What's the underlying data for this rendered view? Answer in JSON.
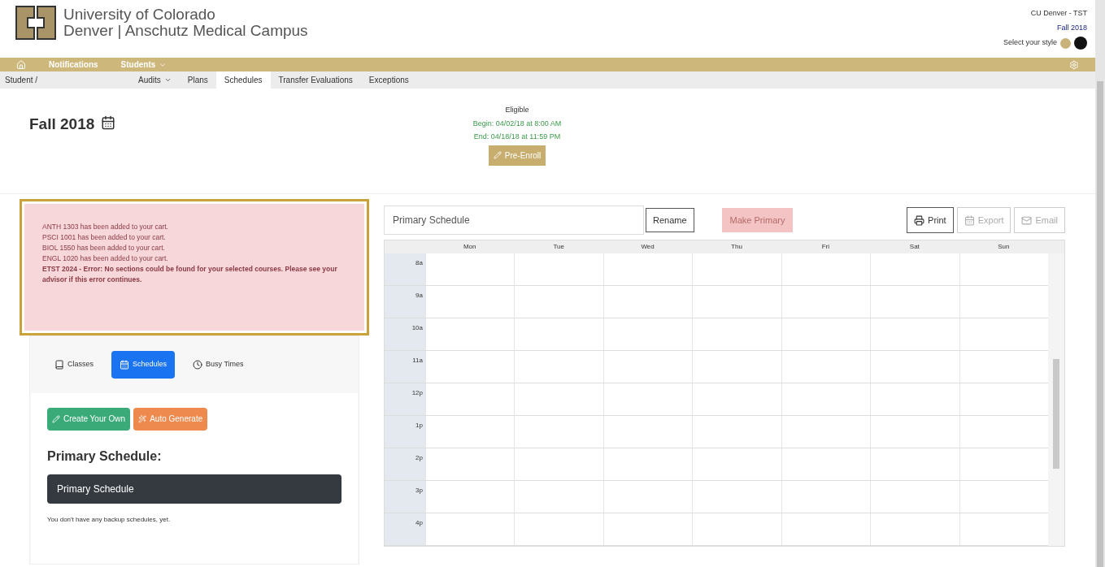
{
  "header": {
    "university": "University of Colorado",
    "campus": "Denver | Anschutz Medical Campus",
    "user": "CU Denver - TST",
    "term": "Fall 2018",
    "style_label": "Select your style",
    "styles": [
      {
        "color": "#c8b27a",
        "selected": false
      },
      {
        "color": "#111111",
        "selected": true
      }
    ]
  },
  "navbar": {
    "items": [
      {
        "label": "Notifications",
        "dropdown": false
      },
      {
        "label": "Students",
        "dropdown": true
      }
    ]
  },
  "subnav": {
    "breadcrumb": "Student /",
    "tabs": [
      {
        "label": "Audits",
        "dropdown": true,
        "selected": false
      },
      {
        "label": "Plans",
        "dropdown": false,
        "selected": false
      },
      {
        "label": "Schedules",
        "dropdown": false,
        "selected": true
      },
      {
        "label": "Transfer Evaluations",
        "dropdown": false,
        "selected": false
      },
      {
        "label": "Exceptions",
        "dropdown": false,
        "selected": false
      }
    ]
  },
  "term_title": "Fall 2018",
  "enrollment": {
    "status": "Eligible",
    "begin": "Begin: 04/02/18 at 8:00 AM",
    "end": "End: 04/18/18 at 11:59 PM",
    "button": "Pre-Enroll"
  },
  "alert": {
    "messages": [
      {
        "text": "ANTH 1303 has been added to your cart.",
        "kind": "info"
      },
      {
        "text": "PSCI 1001 has been added to your cart.",
        "kind": "info"
      },
      {
        "text": "BIOL 1550 has been added to your cart.",
        "kind": "info"
      },
      {
        "text": "ENGL 1020 has been added to your cart.",
        "kind": "info"
      },
      {
        "text": "ETST 2024 - Error: No sections could be found for your selected courses. Please see your advisor if this error continues.",
        "kind": "error"
      }
    ]
  },
  "left_panel": {
    "tabs": [
      {
        "label": "Classes",
        "selected": false
      },
      {
        "label": "Schedules",
        "selected": true
      },
      {
        "label": "Busy Times",
        "selected": false
      }
    ],
    "buttons": [
      {
        "label": "Create Your Own",
        "kind": "create"
      },
      {
        "label": "Auto Generate",
        "kind": "generate"
      }
    ],
    "heading": "Primary Schedule:",
    "primary": "Primary Schedule",
    "note": "You don't have any backup schedules, yet."
  },
  "calendar": {
    "name_value": "Primary Schedule",
    "rename": "Rename",
    "make_primary": {
      "label": "Make Primary",
      "disabled": true
    },
    "actions": [
      {
        "label": "Print",
        "disabled": false,
        "kind": "print"
      },
      {
        "label": "Export",
        "disabled": true,
        "kind": "export"
      },
      {
        "label": "Email",
        "disabled": true,
        "kind": "email"
      }
    ],
    "days": [
      "Mon",
      "Tue",
      "Wed",
      "Thu",
      "Fri",
      "Sat",
      "Sun"
    ],
    "times": [
      "8a",
      "9a",
      "10a",
      "11a",
      "12p",
      "1p",
      "2p",
      "3p",
      "4p"
    ]
  }
}
